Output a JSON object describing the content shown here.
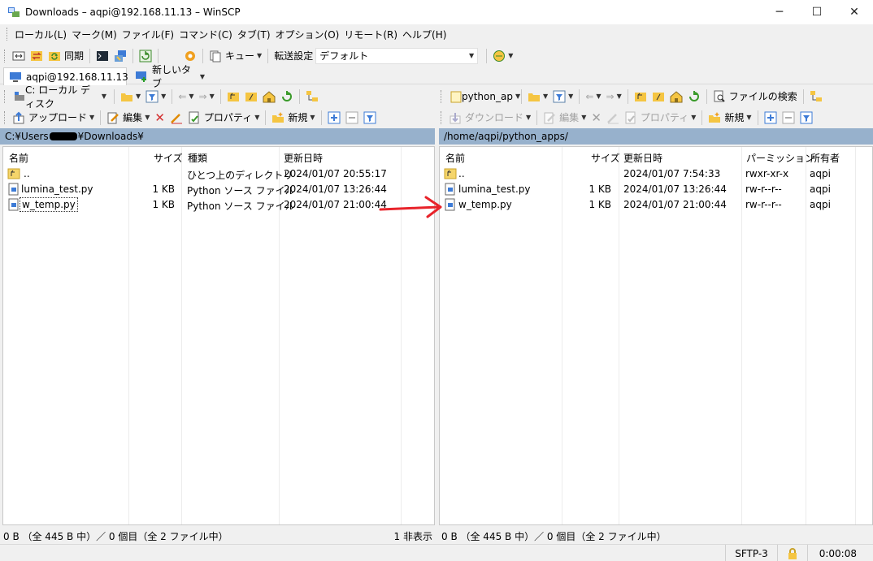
{
  "window": {
    "title": "Downloads – aqpi@192.168.11.13 – WinSCP",
    "minimize": "─",
    "maximize": "☐",
    "close": "✕"
  },
  "menu": [
    "ローカル(L)",
    "マーク(M)",
    "ファイル(F)",
    "コマンド(C)",
    "タブ(T)",
    "オプション(O)",
    "リモート(R)",
    "ヘルプ(H)"
  ],
  "toolbar": {
    "sync": "同期",
    "queue": "キュー",
    "transfer_label": "転送設定",
    "transfer_value": "デフォルト"
  },
  "tabs": {
    "session": "aqpi@192.168.11.13",
    "new_tab": "新しいタブ"
  },
  "left": {
    "drive": "C: ローカル ディスク",
    "upload": "アップロード",
    "edit": "編集",
    "properties": "プロパティ",
    "new": "新規",
    "path_prefix": "C:¥Users",
    "path_suffix": "¥Downloads¥",
    "columns": {
      "name": "名前",
      "size": "サイズ",
      "type": "種類",
      "modified": "更新日時"
    },
    "rows": [
      {
        "name": "..",
        "size": "",
        "type": "ひとつ上のディレクトリ",
        "modified": "2024/01/07 20:55:17"
      },
      {
        "name": "lumina_test.py",
        "size": "1 KB",
        "type": "Python ソース ファイル",
        "modified": "2024/01/07 13:26:44"
      },
      {
        "name": "w_temp.py",
        "size": "1 KB",
        "type": "Python ソース ファイル",
        "modified": "2024/01/07 21:00:44"
      }
    ],
    "status": "0 B （全 445 B 中）／ 0 個目（全 2 ファイル中）",
    "hidden": "1 非表示"
  },
  "right": {
    "folder": "python_ap",
    "find": "ファイルの検索",
    "download": "ダウンロード",
    "edit": "編集",
    "properties": "プロパティ",
    "new": "新規",
    "path": "/home/aqpi/python_apps/",
    "columns": {
      "name": "名前",
      "size": "サイズ",
      "modified": "更新日時",
      "perm": "パーミッション",
      "owner": "所有者"
    },
    "rows": [
      {
        "name": "..",
        "size": "",
        "modified": "2024/01/07 7:54:33",
        "perm": "rwxr-xr-x",
        "owner": "aqpi"
      },
      {
        "name": "lumina_test.py",
        "size": "1 KB",
        "modified": "2024/01/07 13:26:44",
        "perm": "rw-r--r--",
        "owner": "aqpi"
      },
      {
        "name": "w_temp.py",
        "size": "1 KB",
        "modified": "2024/01/07 21:00:44",
        "perm": "rw-r--r--",
        "owner": "aqpi"
      }
    ],
    "status": "0 B （全 445 B 中）／ 0 個目（全 2 ファイル中）"
  },
  "bottom": {
    "protocol": "SFTP-3",
    "elapsed": "0:00:08"
  },
  "colors": {
    "path_bg": "#97b1cc",
    "arrow": "#e8232a",
    "folder": "#f5c542"
  }
}
